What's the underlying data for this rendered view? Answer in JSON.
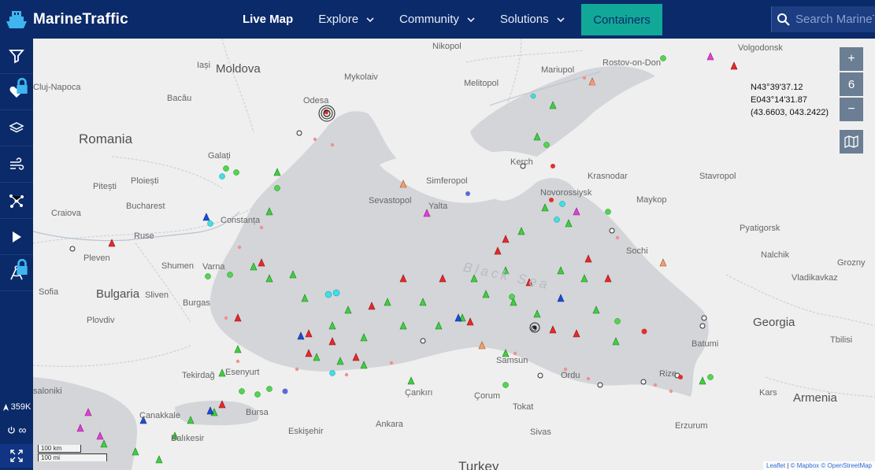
{
  "brand": {
    "name": "MarineTraffic"
  },
  "nav": {
    "live_map": "Live Map",
    "explore": "Explore",
    "community": "Community",
    "solutions": "Solutions",
    "containers": "Containers"
  },
  "search": {
    "placeholder": "Search MarineTraffic"
  },
  "sidebar": {
    "vessel_count": "359K",
    "play_speed": "∞"
  },
  "map": {
    "zoom_level": "6",
    "zoom_in": "+",
    "zoom_out": "−",
    "coordinates": {
      "lat": "N43°39'37.12",
      "lon": "E043°14'31.87",
      "decimal": "(43.6603, 043.2422)"
    },
    "scale": {
      "km": "100 km",
      "mi": "100 mi"
    },
    "attribution": {
      "leaflet": "Leaflet",
      "mapbox": "© Mapbox",
      "osm": "© OpenStreetMap"
    },
    "sea_label": "Black Sea",
    "countries": {
      "moldova": "Moldova",
      "romania": "Romania",
      "bulgaria": "Bulgaria",
      "georgia": "Georgia",
      "armenia": "Armenia",
      "turkey": "Turkey"
    },
    "cities": {
      "nikopol": "Nikopol",
      "rostov": "Rostov-on-Don",
      "cluj": "Cluj-Napoca",
      "bacau": "Bacău",
      "iasi": "Iași",
      "mykolaiv": "Mykolaiv",
      "melitopol": "Melitopol",
      "mariupol": "Mariupol",
      "odesa": "Odesa",
      "galati": "Galați",
      "simferopol": "Simferopol",
      "sevastopol": "Sevastopol",
      "yalta": "Yalta",
      "kerch": "Kerch",
      "krasnodar": "Krasnodar",
      "stavropol": "Stavropol",
      "novorossiysk": "Novorossiysk",
      "maykop": "Maykop",
      "pitesti": "Pitești",
      "ploiesti": "Ploiești",
      "bucharest": "Bucharest",
      "craiova": "Craiova",
      "constanta": "Constanța",
      "pleven": "Pleven",
      "ruse": "Ruse",
      "shumen": "Shumen",
      "varna": "Varna",
      "pyatigorsk": "Pyatigorsk",
      "sochi": "Sochi",
      "nalchik": "Nalchik",
      "grozny": "Grozny",
      "vladikavkaz": "Vladikavkaz",
      "sofia": "Sofia",
      "sliven": "Sliven",
      "burgas": "Burgas",
      "plovdiv": "Plovdiv",
      "tbilisi": "Tbilisi",
      "batumi": "Batumi",
      "samsun": "Samsun",
      "ordu": "Ordu",
      "rize": "Rize",
      "tekirdag": "Tekirdağ",
      "esenyurt": "Esenyurt",
      "bursa": "Bursa",
      "cankiri": "Çankırı",
      "corum": "Çorum",
      "tokat": "Tokat",
      "kars": "Kars",
      "thessaloniki": "saloniki",
      "canakkale": "Çanakkale",
      "balikesir": "Balıkesir",
      "eskisehir": "Eskişehir",
      "ankara": "Ankara",
      "sivas": "Sivas",
      "erzurum": "Erzurum",
      "volgodonsk": "Volgodonsk"
    }
  }
}
